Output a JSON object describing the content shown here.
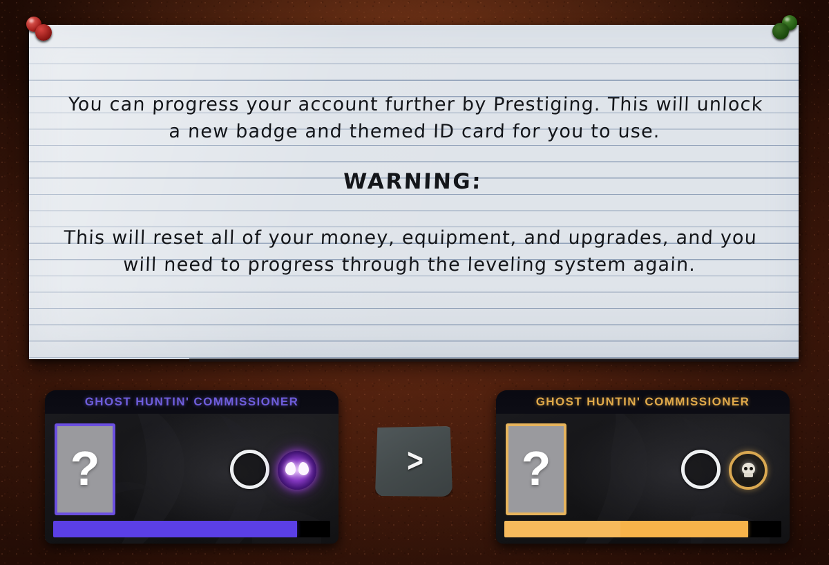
{
  "scene": {
    "background": "corkboard",
    "background_color": "#5a2410"
  },
  "note": {
    "pins": [
      {
        "name": "pin-top-left",
        "color": "#a8201d"
      },
      {
        "name": "pin-top-right",
        "color": "#235c12"
      }
    ],
    "paragraph_1": "You can progress your account further by Prestiging. This will unlock a new badge and themed ID card for you to use.",
    "warning_heading": "WARNING:",
    "paragraph_2": "This will reset all of your money, equipment, and upgrades, and you will need to progress through the leveling system again."
  },
  "cards": {
    "current": {
      "title": "GHOST HUNTIN' COMMISSIONER",
      "title_color": "#6e5ddb",
      "accent_color": "#6b4fe0",
      "id_card_placeholder": "?",
      "badge_icon_name": "purple-brain-badge-icon",
      "empty_slot_icon_name": "empty-ring-icon",
      "progress_percent": 88,
      "progress_color": "#5b3fe6"
    },
    "next": {
      "title": "GHOST HUNTIN' COMMISSIONER",
      "title_color": "#e0a94a",
      "accent_color": "#e7b45c",
      "id_card_placeholder": "?",
      "badge_icon_name": "reaper-skull-badge-icon",
      "empty_slot_icon_name": "empty-ring-icon",
      "progress_percent": 88,
      "progress_color": "#f7b34a"
    }
  },
  "next_button": {
    "label": ">",
    "icon_name": "chevron-right-icon"
  }
}
